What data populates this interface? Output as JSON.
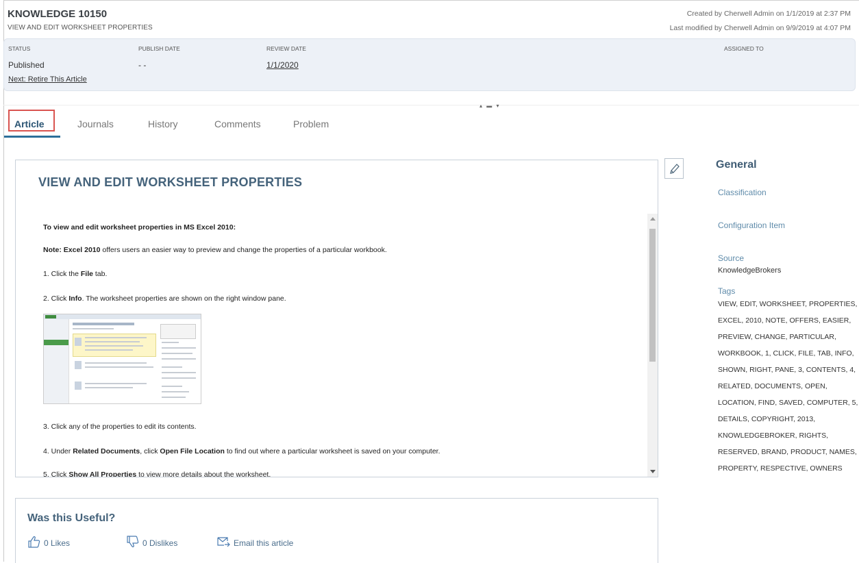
{
  "header": {
    "title": "KNOWLEDGE 10150",
    "subtitle": "VIEW AND EDIT WORKSHEET PROPERTIES",
    "created": "Created by Cherwell Admin on 1/1/2019 at 2:37 PM",
    "modified": "Last modified by Cherwell Admin on 9/9/2019 at 4:07 PM"
  },
  "status_panel": {
    "status_label": "STATUS",
    "status_value": "Published",
    "publish_label": "PUBLISH DATE",
    "publish_value": "- -",
    "review_label": "REVIEW DATE",
    "review_value": "1/1/2020",
    "assigned_label": "ASSIGNED TO",
    "next_action": "Next: Retire This Article"
  },
  "tabs": [
    {
      "label": "Article",
      "active": true
    },
    {
      "label": "Journals",
      "active": false
    },
    {
      "label": "History",
      "active": false
    },
    {
      "label": "Comments",
      "active": false
    },
    {
      "label": "Problem",
      "active": false
    }
  ],
  "article": {
    "title": "VIEW AND EDIT WORKSHEET PROPERTIES",
    "heading": "To view and edit worksheet properties in MS Excel 2010:",
    "note_label": "Note:",
    "note_bold": "Excel 2010",
    "note_text": "offers users an easier way to preview and change the properties of a particular workbook.",
    "step1_a": "1. Click the",
    "step1_b": "File",
    "step1_c": "tab.",
    "step2_a": "2. Click",
    "step2_b": "Info",
    "step2_c": ". The worksheet properties are shown on the right window pane.",
    "step3": "3. Click any of the properties to edit its contents.",
    "step4_a": "4. Under",
    "step4_b": "Related Documents",
    "step4_c": ", click",
    "step4_d": "Open File Location",
    "step4_e": "to find out where a particular worksheet is saved on your computer.",
    "step5_a": "5. Click",
    "step5_b": "Show All Properties",
    "step5_c": "to view more details about the worksheet."
  },
  "general": {
    "title": "General",
    "classification_label": "Classification",
    "config_label": "Configuration Item",
    "source_label": "Source",
    "source_value": "KnowledgeBrokers",
    "tags_label": "Tags",
    "tags_value": "VIEW, EDIT, WORKSHEET, PROPERTIES, EXCEL, 2010, NOTE, OFFERS, EASIER, PREVIEW, CHANGE, PARTICULAR, WORKBOOK, 1, CLICK, FILE, TAB, INFO, SHOWN, RIGHT, PANE, 3, CONTENTS, 4, RELATED, DOCUMENTS, OPEN, LOCATION, FIND, SAVED, COMPUTER, 5, DETAILS, COPYRIGHT, 2013, KNOWLEDGEBROKER, RIGHTS, RESERVED, BRAND, PRODUCT, NAMES, PROPERTY, RESPECTIVE, OWNERS"
  },
  "feedback": {
    "title": "Was this Useful?",
    "likes": "0 Likes",
    "dislikes": "0 Dislikes",
    "email": "Email this article"
  },
  "icons": {
    "edit": "pencil-icon",
    "like": "thumbs-up-icon",
    "dislike": "thumbs-down-icon",
    "email": "email-forward-icon"
  },
  "colors": {
    "accent": "#2c6f9a",
    "highlight": "#d9534f",
    "panel_bg": "#edf1f7",
    "title": "#45637b"
  }
}
